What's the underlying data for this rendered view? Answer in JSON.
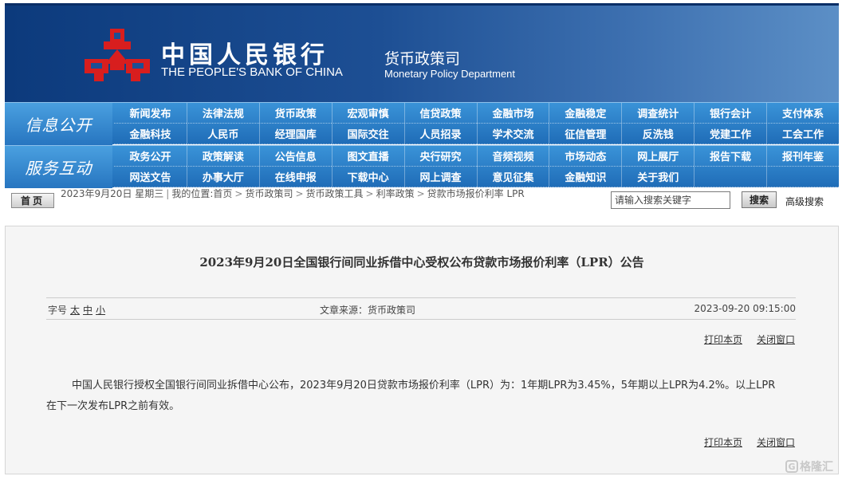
{
  "header": {
    "bank_name_cn": "中国人民银行",
    "bank_name_en": "THE PEOPLE'S BANK OF CHINA",
    "dept_cn": "货币政策司",
    "dept_en": "Monetary Policy Department",
    "emblem_icon": "pboc-emblem-icon",
    "emblem_color": "#d81e1e"
  },
  "nav": {
    "info_title": "信息公开",
    "info_items": [
      "新闻发布",
      "法律法规",
      "货币政策",
      "宏观审慎",
      "信贷政策",
      "金融市场",
      "金融稳定",
      "调查统计",
      "银行会计",
      "支付体系",
      "金融科技",
      "人民币",
      "经理国库",
      "国际交往",
      "人员招录",
      "学术交流",
      "征信管理",
      "反洗钱",
      "党建工作",
      "工会工作"
    ],
    "service_title": "服务互动",
    "service_items": [
      "政务公开",
      "政策解读",
      "公告信息",
      "图文直播",
      "央行研究",
      "音频视频",
      "市场动态",
      "网上展厅",
      "报告下载",
      "报刊年鉴",
      "网送文告",
      "办事大厅",
      "在线申报",
      "下载中心",
      "网上调查",
      "意见征集",
      "金融知识",
      "关于我们",
      "",
      ""
    ]
  },
  "breadcrumb": {
    "home": "首页",
    "date": "2023年9月20日 星期三",
    "location_label": "我的位置:",
    "path": [
      "首页",
      "货币政策司",
      "货币政策工具",
      "利率政策",
      "贷款市场报价利率 LPR"
    ],
    "separator": ">"
  },
  "search": {
    "placeholder": "请输入搜索关键字",
    "button": "搜索",
    "advanced": "高级搜索"
  },
  "article": {
    "title": "2023年9月20日全国银行间同业拆借中心受权公布贷款市场报价利率（LPR）公告",
    "font_size_label": "字号",
    "font_sizes": [
      "太",
      "中",
      "小"
    ],
    "source": "文章来源：货币政策司",
    "date": "2023-09-20  09:15:00",
    "print": "打印本页",
    "close": "关闭窗口",
    "body": "中国人民银行授权全国银行间同业拆借中心公布，2023年9月20日贷款市场报价利率（LPR）为：1年期LPR为3.45%，5年期以上LPR为4.2%。以上LPR在下一次发布LPR之前有效。"
  },
  "watermark": {
    "text": "格隆汇",
    "icon": "g-logo-icon"
  }
}
